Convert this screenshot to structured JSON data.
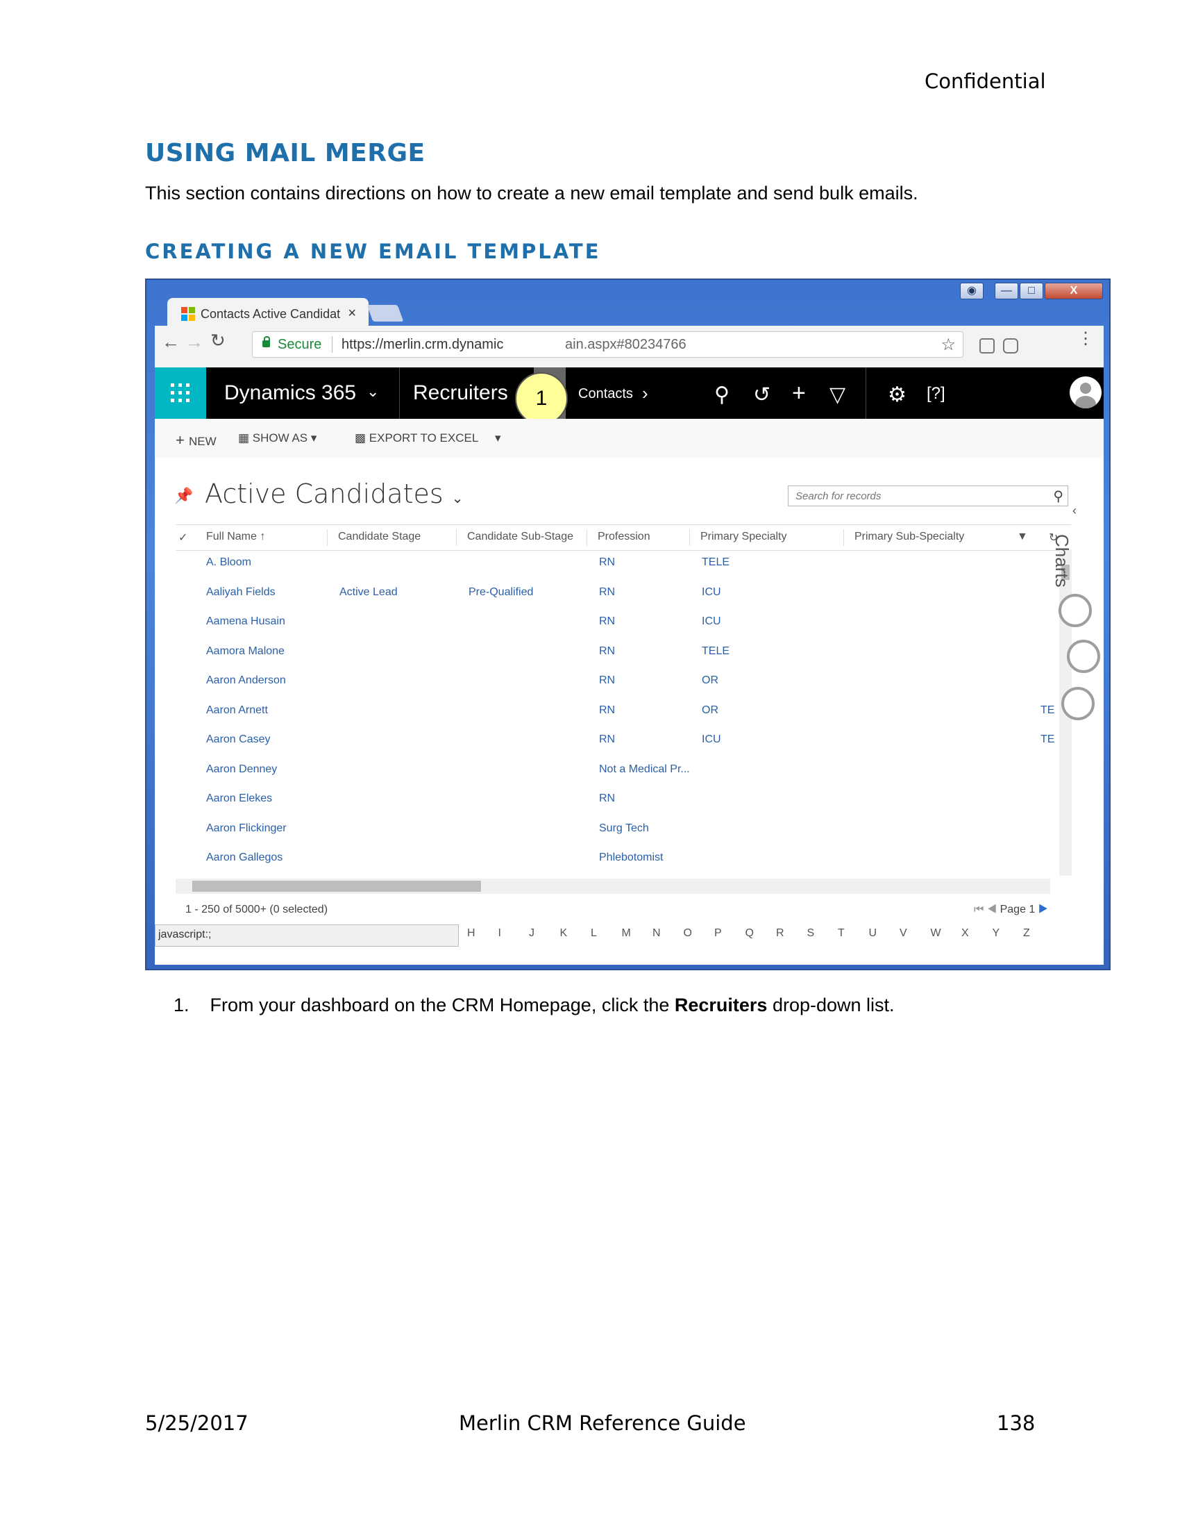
{
  "header": {
    "confidential": "Confidential"
  },
  "doc": {
    "section_title": "USING MAIL MERGE",
    "intro": "This section contains directions on how to create a new email template and send bulk emails.",
    "subsection_title": "CREATING A NEW EMAIL TEMPLATE",
    "step1_number": "1.",
    "step1_pre": "From your dashboard on the CRM Homepage, click the ",
    "step1_bold": "Recruiters",
    "step1_post": " drop-down list."
  },
  "browser": {
    "tab_title": "Contacts Active Candidat",
    "secure_label": "Secure",
    "url_left": "https://merlin.crm.dynamic",
    "url_right": "ain.aspx#80234766",
    "callout": "1"
  },
  "app": {
    "brand": "Dynamics 365",
    "area": "Recruiters",
    "entity": "Contacts",
    "commands": {
      "new": "NEW",
      "show_as": "SHOW AS",
      "export": "EXPORT TO EXCEL"
    },
    "view_title": "Active Candidates",
    "search_placeholder": "Search for records",
    "columns": [
      "Full Name",
      "Candidate Stage",
      "Candidate Sub-Stage",
      "Profession",
      "Primary Specialty",
      "Primary Sub-Specialty"
    ],
    "rows": [
      {
        "name": "A. Bloom",
        "stage": "",
        "sub_stage": "",
        "profession": "RN",
        "specialty": "TELE",
        "sub_specialty": ""
      },
      {
        "name": "Aaliyah Fields",
        "stage": "Active Lead",
        "sub_stage": "Pre-Qualified",
        "profession": "RN",
        "specialty": "ICU",
        "sub_specialty": ""
      },
      {
        "name": "Aamena Husain",
        "stage": "",
        "sub_stage": "",
        "profession": "RN",
        "specialty": "ICU",
        "sub_specialty": ""
      },
      {
        "name": "Aamora Malone",
        "stage": "",
        "sub_stage": "",
        "profession": "RN",
        "specialty": "TELE",
        "sub_specialty": ""
      },
      {
        "name": "Aaron Anderson",
        "stage": "",
        "sub_stage": "",
        "profession": "RN",
        "specialty": "OR",
        "sub_specialty": ""
      },
      {
        "name": "Aaron Arnett",
        "stage": "",
        "sub_stage": "",
        "profession": "RN",
        "specialty": "OR",
        "sub_specialty": "TE"
      },
      {
        "name": "Aaron Casey",
        "stage": "",
        "sub_stage": "",
        "profession": "RN",
        "specialty": "ICU",
        "sub_specialty": "TE"
      },
      {
        "name": "Aaron Denney",
        "stage": "",
        "sub_stage": "",
        "profession": "Not a Medical Pr...",
        "specialty": "",
        "sub_specialty": ""
      },
      {
        "name": "Aaron Elekes",
        "stage": "",
        "sub_stage": "",
        "profession": "RN",
        "specialty": "",
        "sub_specialty": ""
      },
      {
        "name": "Aaron Flickinger",
        "stage": "",
        "sub_stage": "",
        "profession": "Surg Tech",
        "specialty": "",
        "sub_specialty": ""
      },
      {
        "name": "Aaron Gallegos",
        "stage": "",
        "sub_stage": "",
        "profession": "Phlebotomist",
        "specialty": "",
        "sub_specialty": ""
      }
    ],
    "record_count": "1 - 250 of 5000+ (0 selected)",
    "page_label": "Page 1",
    "status_text": "javascript:;",
    "charts_label": "Charts",
    "alphabet": [
      "H",
      "I",
      "J",
      "K",
      "L",
      "M",
      "N",
      "O",
      "P",
      "Q",
      "R",
      "S",
      "T",
      "U",
      "V",
      "W",
      "X",
      "Y",
      "Z"
    ]
  },
  "footer": {
    "date": "5/25/2017",
    "title": "Merlin CRM Reference Guide",
    "page": "138"
  },
  "colors": {
    "heading": "#1f6fab",
    "link": "#2a5fa7",
    "waffle": "#00b7c3",
    "callout": "#ffff99"
  }
}
